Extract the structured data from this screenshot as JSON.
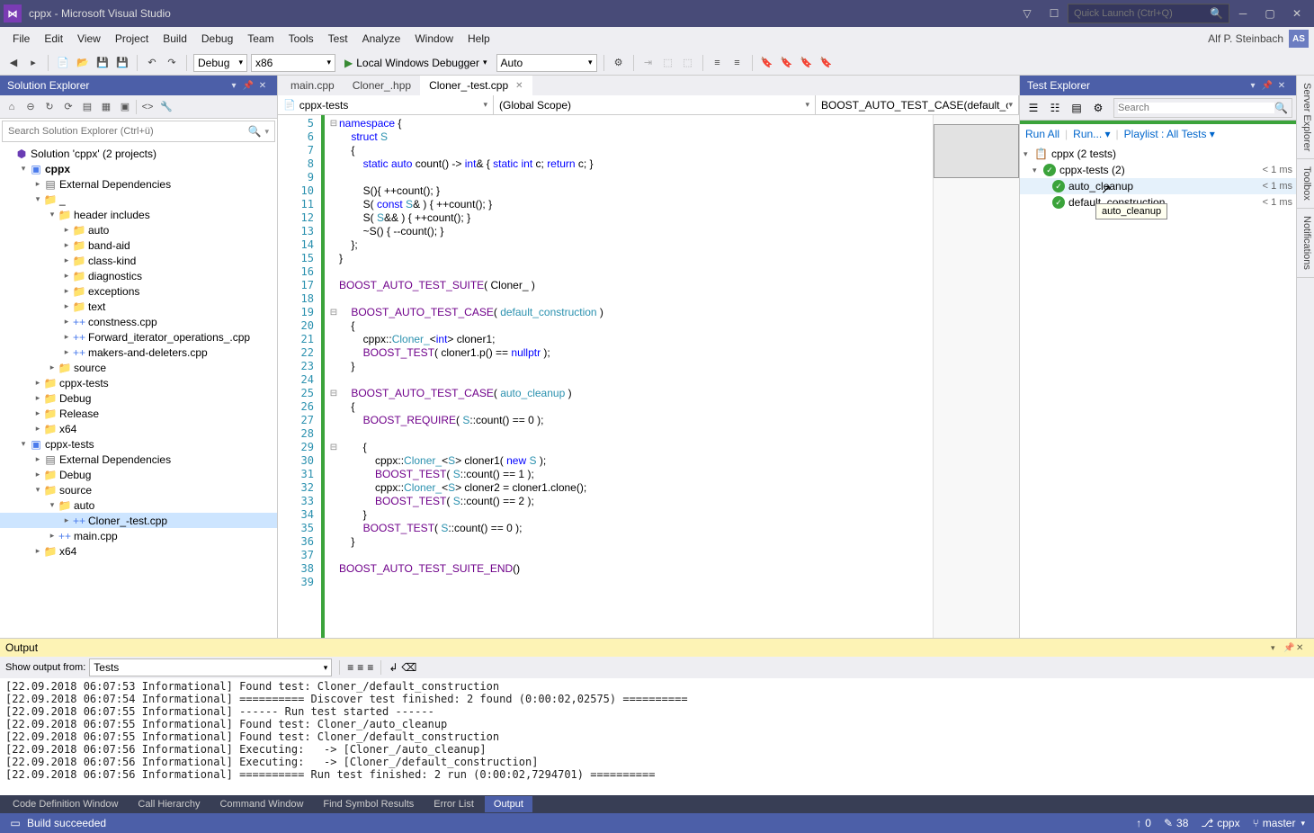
{
  "title": "cppx - Microsoft Visual Studio",
  "quickLaunch": {
    "placeholder": "Quick Launch (Ctrl+Q)"
  },
  "userName": "Alf P. Steinbach",
  "userInitials": "AS",
  "menu": [
    "File",
    "Edit",
    "View",
    "Project",
    "Build",
    "Debug",
    "Team",
    "Tools",
    "Test",
    "Analyze",
    "Window",
    "Help"
  ],
  "toolbar": {
    "config": "Debug",
    "platform": "x86",
    "debugBtn": "Local Windows Debugger",
    "auto": "Auto"
  },
  "solutionExplorer": {
    "title": "Solution Explorer",
    "searchPlaceholder": "Search Solution Explorer (Ctrl+ü)",
    "tree": [
      {
        "depth": 0,
        "exp": "",
        "icon": "sol",
        "label": "Solution 'cppx' (2 projects)"
      },
      {
        "depth": 1,
        "exp": "▾",
        "icon": "proj",
        "label": "cppx",
        "bold": true
      },
      {
        "depth": 2,
        "exp": "▸",
        "icon": "ref",
        "label": "External Dependencies"
      },
      {
        "depth": 2,
        "exp": "▾",
        "icon": "folder",
        "label": "_"
      },
      {
        "depth": 3,
        "exp": "▾",
        "icon": "folder",
        "label": "header includes"
      },
      {
        "depth": 4,
        "exp": "▸",
        "icon": "folder",
        "label": "auto"
      },
      {
        "depth": 4,
        "exp": "▸",
        "icon": "folder",
        "label": "band-aid"
      },
      {
        "depth": 4,
        "exp": "▸",
        "icon": "folder",
        "label": "class-kind"
      },
      {
        "depth": 4,
        "exp": "▸",
        "icon": "folder",
        "label": "diagnostics"
      },
      {
        "depth": 4,
        "exp": "▸",
        "icon": "folder",
        "label": "exceptions"
      },
      {
        "depth": 4,
        "exp": "▸",
        "icon": "folder",
        "label": "text"
      },
      {
        "depth": 4,
        "exp": "▸",
        "icon": "cpp",
        "label": "constness.cpp"
      },
      {
        "depth": 4,
        "exp": "▸",
        "icon": "cpp",
        "label": "Forward_iterator_operations_.cpp"
      },
      {
        "depth": 4,
        "exp": "▸",
        "icon": "cpp",
        "label": "makers-and-deleters.cpp"
      },
      {
        "depth": 3,
        "exp": "▸",
        "icon": "folder",
        "label": "source"
      },
      {
        "depth": 2,
        "exp": "▸",
        "icon": "folder",
        "label": "cppx-tests"
      },
      {
        "depth": 2,
        "exp": "▸",
        "icon": "folder",
        "label": "Debug"
      },
      {
        "depth": 2,
        "exp": "▸",
        "icon": "folder",
        "label": "Release"
      },
      {
        "depth": 2,
        "exp": "▸",
        "icon": "folder",
        "label": "x64"
      },
      {
        "depth": 1,
        "exp": "▾",
        "icon": "proj",
        "label": "cppx-tests"
      },
      {
        "depth": 2,
        "exp": "▸",
        "icon": "ref",
        "label": "External Dependencies"
      },
      {
        "depth": 2,
        "exp": "▸",
        "icon": "folder",
        "label": "Debug"
      },
      {
        "depth": 2,
        "exp": "▾",
        "icon": "folder",
        "label": "source"
      },
      {
        "depth": 3,
        "exp": "▾",
        "icon": "folder",
        "label": "auto"
      },
      {
        "depth": 4,
        "exp": "▸",
        "icon": "cpp",
        "label": "Cloner_-test.cpp",
        "sel": true
      },
      {
        "depth": 3,
        "exp": "▸",
        "icon": "cpp",
        "label": "main.cpp"
      },
      {
        "depth": 2,
        "exp": "▸",
        "icon": "folder",
        "label": "x64"
      }
    ]
  },
  "editor": {
    "tabs": [
      {
        "label": "main.cpp",
        "active": false
      },
      {
        "label": "Cloner_.hpp",
        "active": false
      },
      {
        "label": "Cloner_-test.cpp",
        "active": true,
        "close": true
      }
    ],
    "nav": {
      "left": "cppx-tests",
      "mid": "(Global Scope)",
      "right": "BOOST_AUTO_TEST_CASE(default_constr"
    },
    "firstLine": 5,
    "lines": [
      {
        "fold": "⊟",
        "html": "<span class='kw'>namespace</span> {"
      },
      {
        "fold": "",
        "html": "    <span class='kw'>struct</span> <span class='typ'>S</span>"
      },
      {
        "fold": "",
        "html": "    {"
      },
      {
        "fold": "",
        "html": "        <span class='kw'>static</span> <span class='kw'>auto</span> count() -&gt; <span class='kw'>int</span>&amp; { <span class='kw'>static</span> <span class='kw'>int</span> c; <span class='kw'>return</span> c; }"
      },
      {
        "fold": "",
        "html": ""
      },
      {
        "fold": "",
        "html": "        S(){ ++count(); }"
      },
      {
        "fold": "",
        "html": "        S( <span class='kw'>const</span> <span class='typ'>S</span>&amp; ) { ++count(); }"
      },
      {
        "fold": "",
        "html": "        S( <span class='typ'>S</span>&amp;&amp; ) { ++count(); }"
      },
      {
        "fold": "",
        "html": "        ~S() { --count(); }"
      },
      {
        "fold": "",
        "html": "    };"
      },
      {
        "fold": "",
        "html": "}"
      },
      {
        "fold": "",
        "html": ""
      },
      {
        "fold": "",
        "html": "<span class='mac'>BOOST_AUTO_TEST_SUITE</span>( Cloner_ )"
      },
      {
        "fold": "",
        "html": ""
      },
      {
        "fold": "⊟",
        "html": "    <span class='mac'>BOOST_AUTO_TEST_CASE</span>( <span class='typ'>default_construction</span> )"
      },
      {
        "fold": "",
        "html": "    {"
      },
      {
        "fold": "",
        "html": "        cppx::<span class='typ'>Cloner_</span>&lt;<span class='kw'>int</span>&gt; cloner1;"
      },
      {
        "fold": "",
        "html": "        <span class='mac'>BOOST_TEST</span>( cloner1.p() == <span class='kw'>nullptr</span> );"
      },
      {
        "fold": "",
        "html": "    }"
      },
      {
        "fold": "",
        "html": ""
      },
      {
        "fold": "⊟",
        "html": "    <span class='mac'>BOOST_AUTO_TEST_CASE</span>( <span class='typ'>auto_cleanup</span> )"
      },
      {
        "fold": "",
        "html": "    {"
      },
      {
        "fold": "",
        "html": "        <span class='mac'>BOOST_REQUIRE</span>( <span class='typ'>S</span>::count() == 0 );"
      },
      {
        "fold": "",
        "html": ""
      },
      {
        "fold": "⊟",
        "html": "        {"
      },
      {
        "fold": "",
        "html": "            cppx::<span class='typ'>Cloner_</span>&lt;<span class='typ'>S</span>&gt; cloner1( <span class='kw'>new</span> <span class='typ'>S</span> );"
      },
      {
        "fold": "",
        "html": "            <span class='mac'>BOOST_TEST</span>( <span class='typ'>S</span>::count() == 1 );"
      },
      {
        "fold": "",
        "html": "            cppx::<span class='typ'>Cloner_</span>&lt;<span class='typ'>S</span>&gt; cloner2 = cloner1.clone();"
      },
      {
        "fold": "",
        "html": "            <span class='mac'>BOOST_TEST</span>( <span class='typ'>S</span>::count() == 2 );"
      },
      {
        "fold": "",
        "html": "        }"
      },
      {
        "fold": "",
        "html": "        <span class='mac'>BOOST_TEST</span>( <span class='typ'>S</span>::count() == 0 );"
      },
      {
        "fold": "",
        "html": "    }"
      },
      {
        "fold": "",
        "html": ""
      },
      {
        "fold": "",
        "html": "<span class='mac'>BOOST_AUTO_TEST_SUITE_END</span>()"
      },
      {
        "fold": "",
        "html": ""
      }
    ]
  },
  "testExplorer": {
    "title": "Test Explorer",
    "searchPlaceholder": "Search",
    "links": {
      "runAll": "Run All",
      "run": "Run...",
      "playlist": "Playlist : All Tests"
    },
    "root": "cppx (2 tests)",
    "suite": {
      "name": "cppx-tests (2)",
      "time": "< 1 ms"
    },
    "tests": [
      {
        "name": "auto_cleanup",
        "time": "< 1 ms",
        "hov": true
      },
      {
        "name": "default_construction",
        "time": "< 1 ms"
      }
    ],
    "tooltip": "auto_cleanup"
  },
  "rightRails": [
    "Server Explorer",
    "Toolbox",
    "Notifications"
  ],
  "output": {
    "title": "Output",
    "showFrom": "Show output from:",
    "source": "Tests",
    "lines": [
      "[22.09.2018 06:07:53 Informational] Found test: Cloner_/default_construction",
      "[22.09.2018 06:07:54 Informational] ========== Discover test finished: 2 found (0:00:02,02575) ==========",
      "[22.09.2018 06:07:55 Informational] ------ Run test started ------",
      "[22.09.2018 06:07:55 Informational] Found test: Cloner_/auto_cleanup",
      "[22.09.2018 06:07:55 Informational] Found test: Cloner_/default_construction",
      "[22.09.2018 06:07:56 Informational] Executing:   -> [Cloner_/auto_cleanup]",
      "[22.09.2018 06:07:56 Informational] Executing:   -> [Cloner_/default_construction]",
      "[22.09.2018 06:07:56 Informational] ========== Run test finished: 2 run (0:00:02,7294701) =========="
    ]
  },
  "bottomTabs": [
    "Code Definition Window",
    "Call Hierarchy",
    "Command Window",
    "Find Symbol Results",
    "Error List",
    "Output"
  ],
  "status": {
    "msg": "Build succeeded",
    "pub": "0",
    "changes": "38",
    "repo": "cppx",
    "branch": "master"
  }
}
